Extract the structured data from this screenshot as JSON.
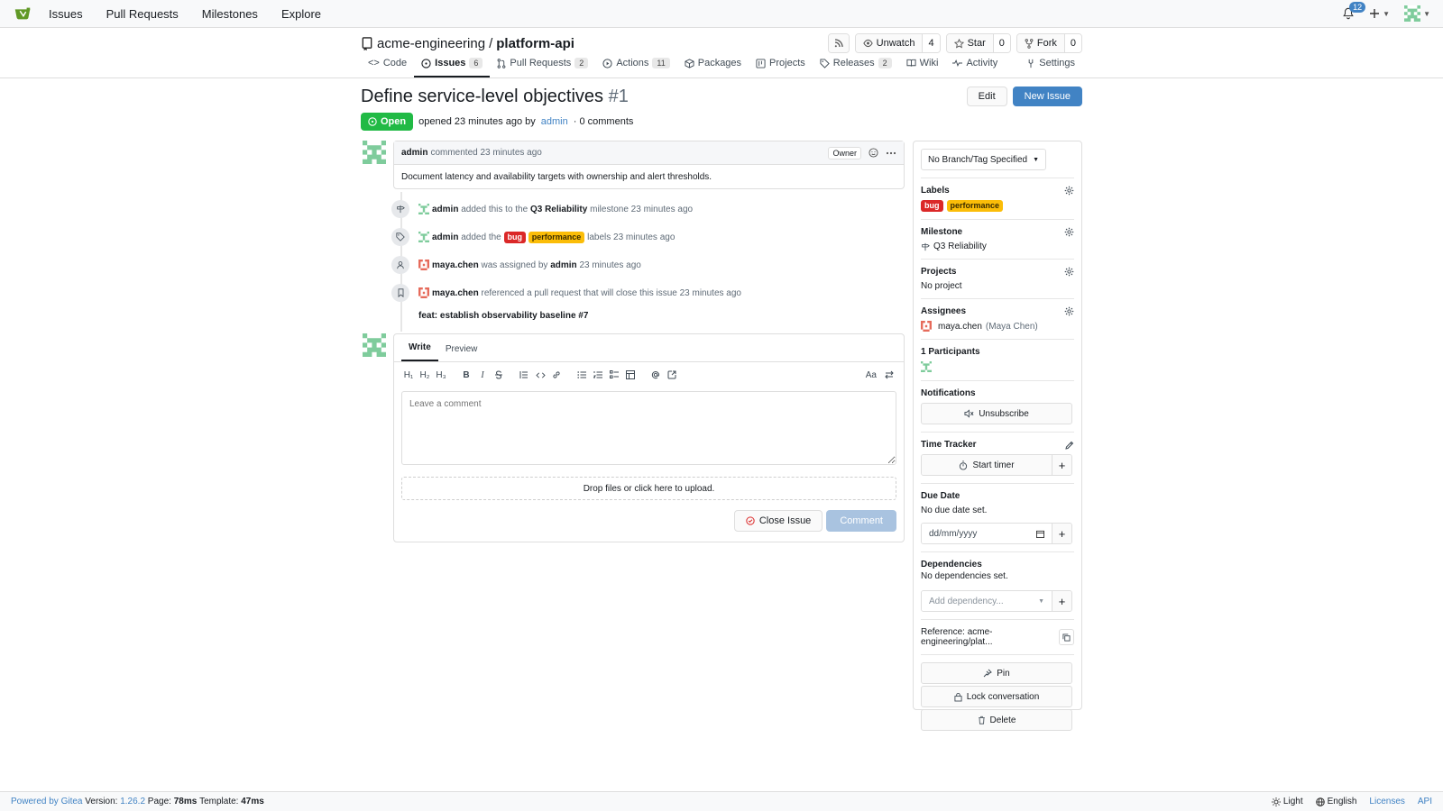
{
  "colors": {
    "accent": "#4183c4",
    "open": "#21ba45",
    "bug": "#db2828",
    "performance": "#fbbd08"
  },
  "topnav": {
    "items": [
      "Issues",
      "Pull Requests",
      "Milestones",
      "Explore"
    ],
    "notifications_count": "12"
  },
  "repo": {
    "owner": "acme-engineering",
    "separator": "/",
    "name": "platform-api",
    "watch_label": "Unwatch",
    "watch_count": "4",
    "star_label": "Star",
    "star_count": "0",
    "fork_label": "Fork",
    "fork_count": "0"
  },
  "tabs": {
    "code": "Code",
    "issues": "Issues",
    "issues_count": "6",
    "pulls": "Pull Requests",
    "pulls_count": "2",
    "actions": "Actions",
    "actions_count": "11",
    "packages": "Packages",
    "projects": "Projects",
    "releases": "Releases",
    "releases_count": "2",
    "wiki": "Wiki",
    "activity": "Activity",
    "settings": "Settings"
  },
  "issue": {
    "title": "Define service-level objectives",
    "number": "#1",
    "edit_label": "Edit",
    "new_issue_label": "New Issue",
    "state": "Open",
    "opened_text": "opened 23 minutes ago by",
    "author": "admin",
    "comments_text": "· 0 comments"
  },
  "comment": {
    "author": "admin",
    "action": "commented 23 minutes ago",
    "owner_badge": "Owner",
    "body": "Document latency and availability targets with ownership and alert thresholds."
  },
  "timeline": {
    "milestone": {
      "user": "admin",
      "pre": "added this to the",
      "target": "Q3 Reliability",
      "post": "milestone 23 minutes ago"
    },
    "labels": {
      "user": "admin",
      "pre": "added the",
      "label1": "bug",
      "label2": "performance",
      "post": "labels 23 minutes ago"
    },
    "assign": {
      "user": "maya.chen",
      "pre": "was assigned by",
      "by": "admin",
      "post": "23 minutes ago"
    },
    "ref": {
      "user": "maya.chen",
      "text": "referenced a pull request that will close this issue 23 minutes ago",
      "pr": "feat: establish observability baseline #7"
    }
  },
  "editor": {
    "tab_write": "Write",
    "tab_preview": "Preview",
    "placeholder": "Leave a comment",
    "dropzone": "Drop files or click here to upload.",
    "close_issue": "Close Issue",
    "comment": "Comment",
    "toolbar": {
      "h1": "H₁",
      "h2": "H₂",
      "h3": "H₃",
      "bold": "B",
      "italic": "I",
      "font": "Aa"
    }
  },
  "sidebar": {
    "branch": "No Branch/Tag Specified",
    "labels_title": "Labels",
    "label1": "bug",
    "label2": "performance",
    "milestone_title": "Milestone",
    "milestone_value": "Q3 Reliability",
    "projects_title": "Projects",
    "projects_value": "No project",
    "assignees_title": "Assignees",
    "assignee_user": "maya.chen",
    "assignee_full": "(Maya Chen)",
    "participants_title": "1 Participants",
    "notifications_title": "Notifications",
    "unsubscribe": "Unsubscribe",
    "time_tracker_title": "Time Tracker",
    "start_timer": "Start timer",
    "due_date_title": "Due Date",
    "due_date_value": "No due date set.",
    "date_placeholder": "dd/mm/yyyy",
    "dependencies_title": "Dependencies",
    "dependencies_value": "No dependencies set.",
    "add_dependency": "Add dependency...",
    "reference": "Reference: acme-engineering/plat...",
    "pin": "Pin",
    "lock": "Lock conversation",
    "delete": "Delete"
  },
  "footer": {
    "powered": "Powered by Gitea",
    "version_label": "Version:",
    "version": "1.26.2",
    "page_label": "Page:",
    "page_time": "78ms",
    "template_label": "Template:",
    "template_time": "47ms",
    "theme": "Light",
    "language": "English",
    "licenses": "Licenses",
    "api": "API"
  }
}
